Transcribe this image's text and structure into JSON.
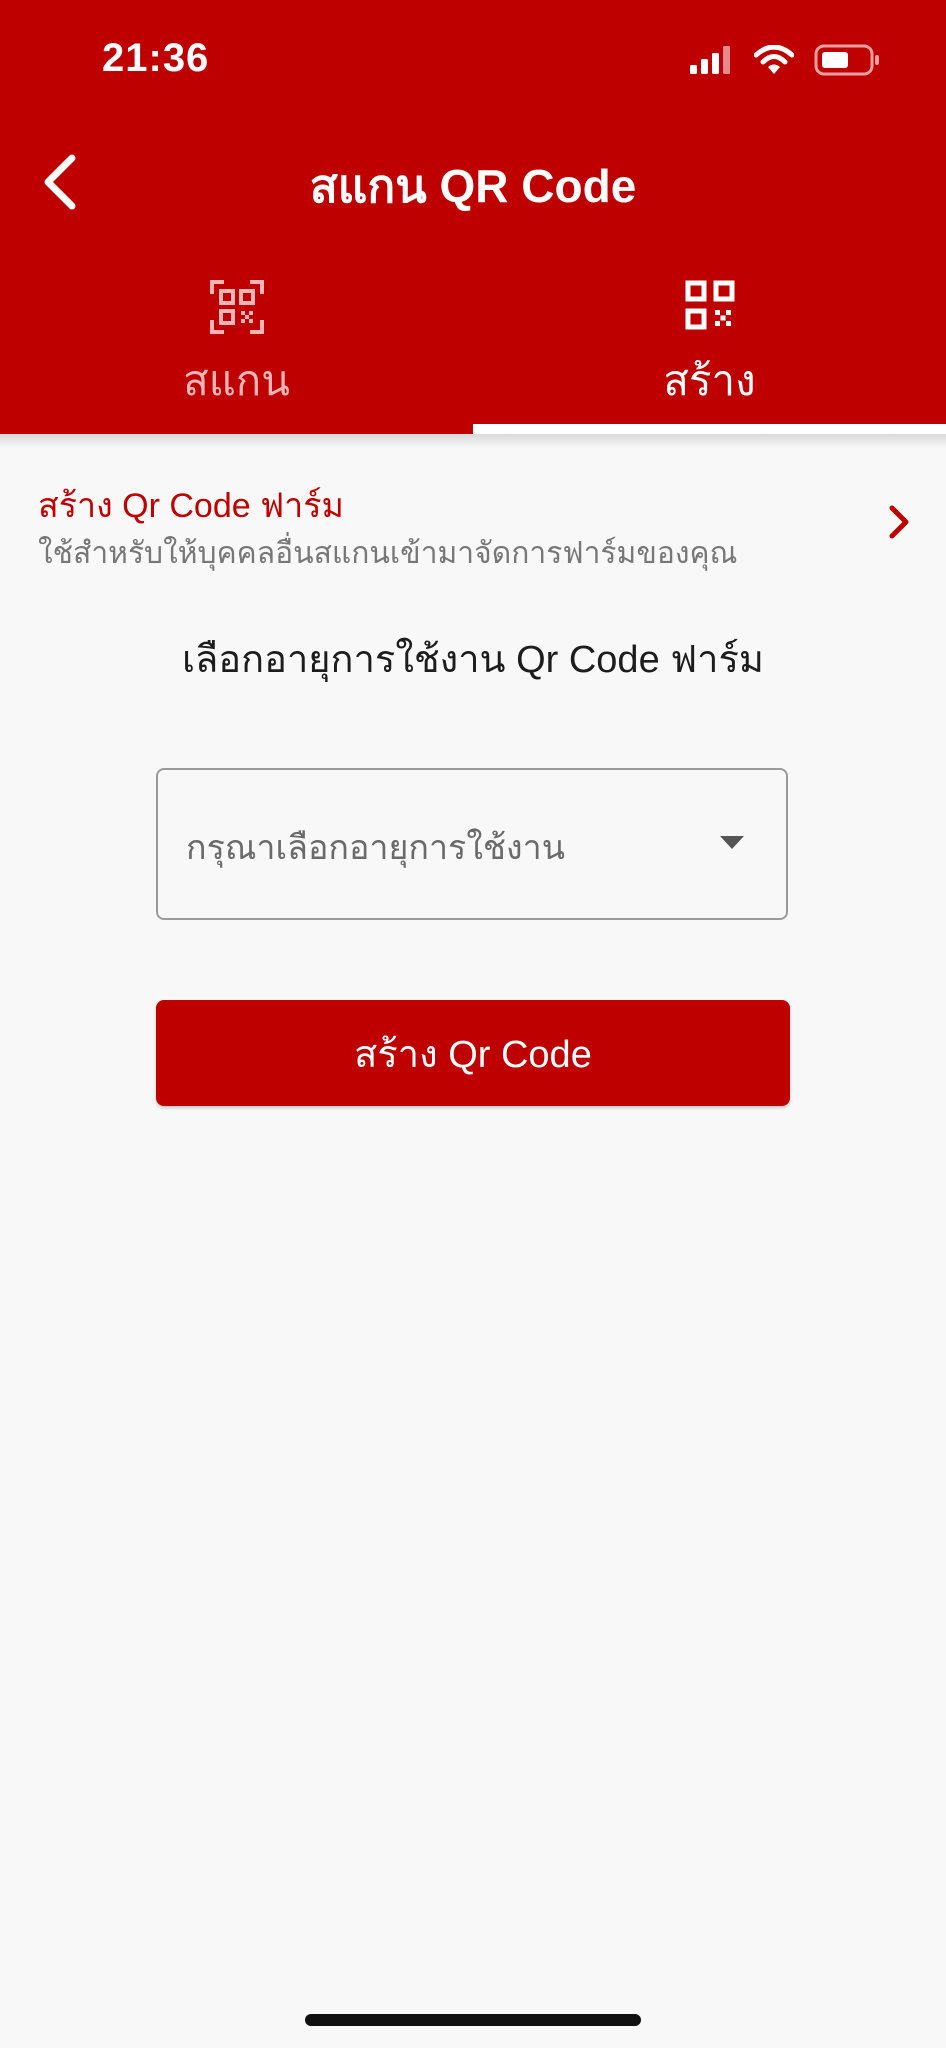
{
  "status_bar": {
    "time": "21:36",
    "icons": [
      "cellular-signal-icon",
      "wifi-icon",
      "battery-icon"
    ]
  },
  "header": {
    "title": "สแกน QR Code",
    "back_icon": "chevron-left-icon",
    "background_color": "#bf0000"
  },
  "tabs": [
    {
      "label": "สแกน",
      "icon": "qr-scan-icon",
      "active": false
    },
    {
      "label": "สร้าง",
      "icon": "qr-code-icon",
      "active": true
    }
  ],
  "form_link": {
    "title": "สร้าง Qr Code ฟาร์ม",
    "subtitle": "ใช้สำหรับให้บุคคลอื่นสแกนเข้ามาจัดการฟาร์มของคุณ",
    "icon": "chevron-right-icon"
  },
  "section": {
    "heading": "เลือกอายุการใช้งาน Qr Code ฟาร์ม"
  },
  "duration_select": {
    "placeholder": "กรุณาเลือกอายุการใช้งาน",
    "icon": "caret-down-icon"
  },
  "create_button": {
    "label": "สร้าง Qr Code"
  }
}
